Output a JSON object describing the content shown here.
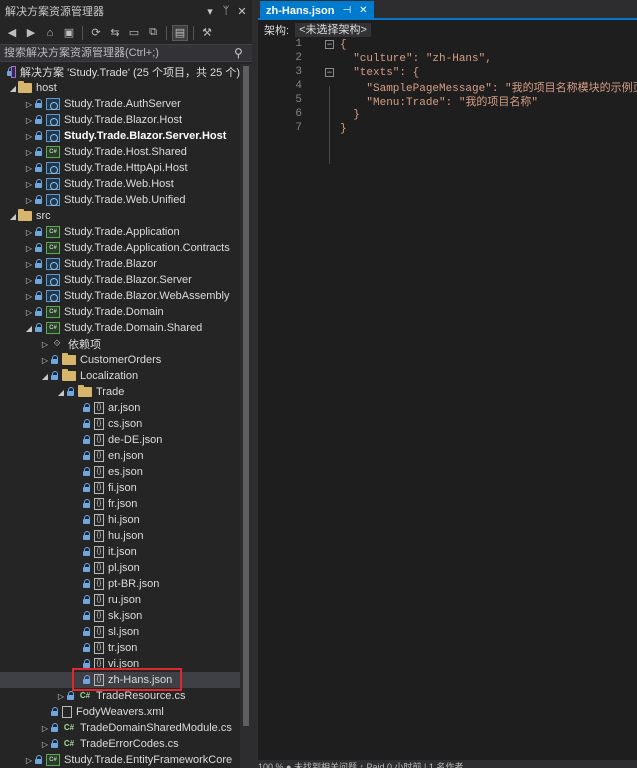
{
  "solution_explorer": {
    "title": "解决方案资源管理器",
    "pin": "ᛘ",
    "close": "✕",
    "menu": "▾",
    "search_placeholder": "搜索解决方案资源管理器(Ctrl+;)",
    "toolbar": [
      "◀",
      "▶",
      "⌂",
      "▣",
      "⟳",
      "⇆",
      "▭",
      "⧉",
      "▤",
      "⚒"
    ]
  },
  "tree": [
    {
      "label": "解决方案 'Study.Trade' (25 个项目，共 25 个)",
      "icon": "sln",
      "indent": 0,
      "arrow": "",
      "lock": true
    },
    {
      "label": "host",
      "icon": "folder",
      "indent": 1,
      "arrow": "◢",
      "lock": false
    },
    {
      "label": "Study.Trade.AuthServer",
      "icon": "web",
      "indent": 2,
      "arrow": "▷",
      "lock": true
    },
    {
      "label": "Study.Trade.Blazor.Host",
      "icon": "web",
      "indent": 2,
      "arrow": "▷",
      "lock": true
    },
    {
      "label": "Study.Trade.Blazor.Server.Host",
      "icon": "web",
      "indent": 2,
      "arrow": "▷",
      "lock": true,
      "bold": true
    },
    {
      "label": "Study.Trade.Host.Shared",
      "icon": "cs",
      "indent": 2,
      "arrow": "▷",
      "lock": true
    },
    {
      "label": "Study.Trade.HttpApi.Host",
      "icon": "web",
      "indent": 2,
      "arrow": "▷",
      "lock": true
    },
    {
      "label": "Study.Trade.Web.Host",
      "icon": "web",
      "indent": 2,
      "arrow": "▷",
      "lock": true
    },
    {
      "label": "Study.Trade.Web.Unified",
      "icon": "web",
      "indent": 2,
      "arrow": "▷",
      "lock": true
    },
    {
      "label": "src",
      "icon": "folder",
      "indent": 1,
      "arrow": "◢",
      "lock": false
    },
    {
      "label": "Study.Trade.Application",
      "icon": "cs",
      "indent": 2,
      "arrow": "▷",
      "lock": true
    },
    {
      "label": "Study.Trade.Application.Contracts",
      "icon": "cs",
      "indent": 2,
      "arrow": "▷",
      "lock": true
    },
    {
      "label": "Study.Trade.Blazor",
      "icon": "web",
      "indent": 2,
      "arrow": "▷",
      "lock": true
    },
    {
      "label": "Study.Trade.Blazor.Server",
      "icon": "web",
      "indent": 2,
      "arrow": "▷",
      "lock": true
    },
    {
      "label": "Study.Trade.Blazor.WebAssembly",
      "icon": "web",
      "indent": 2,
      "arrow": "▷",
      "lock": true
    },
    {
      "label": "Study.Trade.Domain",
      "icon": "cs",
      "indent": 2,
      "arrow": "▷",
      "lock": true
    },
    {
      "label": "Study.Trade.Domain.Shared",
      "icon": "cs",
      "indent": 2,
      "arrow": "◢",
      "lock": true
    },
    {
      "label": "依赖项",
      "icon": "dep",
      "indent": 3,
      "arrow": "▷",
      "lock": false
    },
    {
      "label": "CustomerOrders",
      "icon": "folder",
      "indent": 3,
      "arrow": "▷",
      "lock": true
    },
    {
      "label": "Localization",
      "icon": "folder",
      "indent": 3,
      "arrow": "◢",
      "lock": true
    },
    {
      "label": "Trade",
      "icon": "folder",
      "indent": 4,
      "arrow": "◢",
      "lock": true
    },
    {
      "label": "ar.json",
      "icon": "json",
      "indent": 5,
      "arrow": "",
      "lock": true
    },
    {
      "label": "cs.json",
      "icon": "json",
      "indent": 5,
      "arrow": "",
      "lock": true
    },
    {
      "label": "de-DE.json",
      "icon": "json",
      "indent": 5,
      "arrow": "",
      "lock": true
    },
    {
      "label": "en.json",
      "icon": "json",
      "indent": 5,
      "arrow": "",
      "lock": true
    },
    {
      "label": "es.json",
      "icon": "json",
      "indent": 5,
      "arrow": "",
      "lock": true
    },
    {
      "label": "fi.json",
      "icon": "json",
      "indent": 5,
      "arrow": "",
      "lock": true
    },
    {
      "label": "fr.json",
      "icon": "json",
      "indent": 5,
      "arrow": "",
      "lock": true
    },
    {
      "label": "hi.json",
      "icon": "json",
      "indent": 5,
      "arrow": "",
      "lock": true
    },
    {
      "label": "hu.json",
      "icon": "json",
      "indent": 5,
      "arrow": "",
      "lock": true
    },
    {
      "label": "it.json",
      "icon": "json",
      "indent": 5,
      "arrow": "",
      "lock": true
    },
    {
      "label": "pl.json",
      "icon": "json",
      "indent": 5,
      "arrow": "",
      "lock": true
    },
    {
      "label": "pt-BR.json",
      "icon": "json",
      "indent": 5,
      "arrow": "",
      "lock": true
    },
    {
      "label": "ru.json",
      "icon": "json",
      "indent": 5,
      "arrow": "",
      "lock": true
    },
    {
      "label": "sk.json",
      "icon": "json",
      "indent": 5,
      "arrow": "",
      "lock": true
    },
    {
      "label": "sl.json",
      "icon": "json",
      "indent": 5,
      "arrow": "",
      "lock": true
    },
    {
      "label": "tr.json",
      "icon": "json",
      "indent": 5,
      "arrow": "",
      "lock": true
    },
    {
      "label": "vi.json",
      "icon": "json",
      "indent": 5,
      "arrow": "",
      "lock": true
    },
    {
      "label": "zh-Hans.json",
      "icon": "json",
      "indent": 5,
      "arrow": "",
      "lock": true,
      "selected": true
    },
    {
      "label": "TradeResource.cs",
      "icon": "csfile",
      "indent": 4,
      "arrow": "▷",
      "lock": true
    },
    {
      "label": "FodyWeavers.xml",
      "icon": "xml",
      "indent": 3,
      "arrow": "",
      "lock": true
    },
    {
      "label": "TradeDomainSharedModule.cs",
      "icon": "csfile",
      "indent": 3,
      "arrow": "▷",
      "lock": true
    },
    {
      "label": "TradeErrorCodes.cs",
      "icon": "csfile",
      "indent": 3,
      "arrow": "▷",
      "lock": true
    },
    {
      "label": "Study.Trade.EntityFrameworkCore",
      "icon": "cs",
      "indent": 2,
      "arrow": "▷",
      "lock": true
    }
  ],
  "editor": {
    "tab_title": "zh-Hans.json",
    "tab_pin": "⊣",
    "tab_close": "✕",
    "schema_label": "架构:",
    "schema_value": "<未选择架构>",
    "lines": [
      {
        "n": "1",
        "fold": "⊟",
        "text": "{"
      },
      {
        "n": "2",
        "fold": "",
        "text": "  \"culture\": \"zh-Hans\","
      },
      {
        "n": "3",
        "fold": "⊟",
        "text": "  \"texts\": {"
      },
      {
        "n": "4",
        "fold": "",
        "text": "    \"SamplePageMessage\": \"我的项目名称模块的示例页面\","
      },
      {
        "n": "5",
        "fold": "",
        "text": "    \"Menu:Trade\": \"我的项目名称\""
      },
      {
        "n": "6",
        "fold": "",
        "text": "  }"
      },
      {
        "n": "7",
        "fold": "",
        "text": "}"
      }
    ],
    "status": "100 %    ●  未找到相关问题    ↑ Paid  0  小时前  |  1  名作者"
  },
  "colors": {
    "accent": "#007acc",
    "highlight_box": "#e0272d",
    "string": "#d69d85"
  }
}
